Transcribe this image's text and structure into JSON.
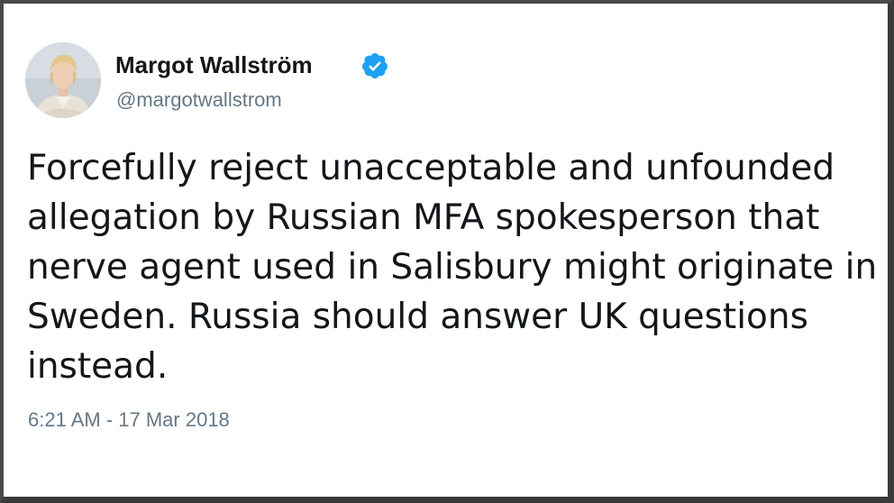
{
  "tweet": {
    "author": {
      "display_name": "Margot Wallström",
      "handle": "@margotwallstrom",
      "verified": true,
      "avatar_icon": "profile-photo"
    },
    "text": "Forcefully reject unacceptable and unfounded allegation by Russian MFA spokesperson that nerve agent used in Salisbury might originate in Sweden. Russia should answer UK questions instead.",
    "timestamp": "6:21 AM - 17 Mar 2018"
  },
  "colors": {
    "verified_badge": "#1da1f2",
    "secondary_text": "#657786",
    "primary_text": "#14171a",
    "frame_border": "#3a3a3a"
  }
}
